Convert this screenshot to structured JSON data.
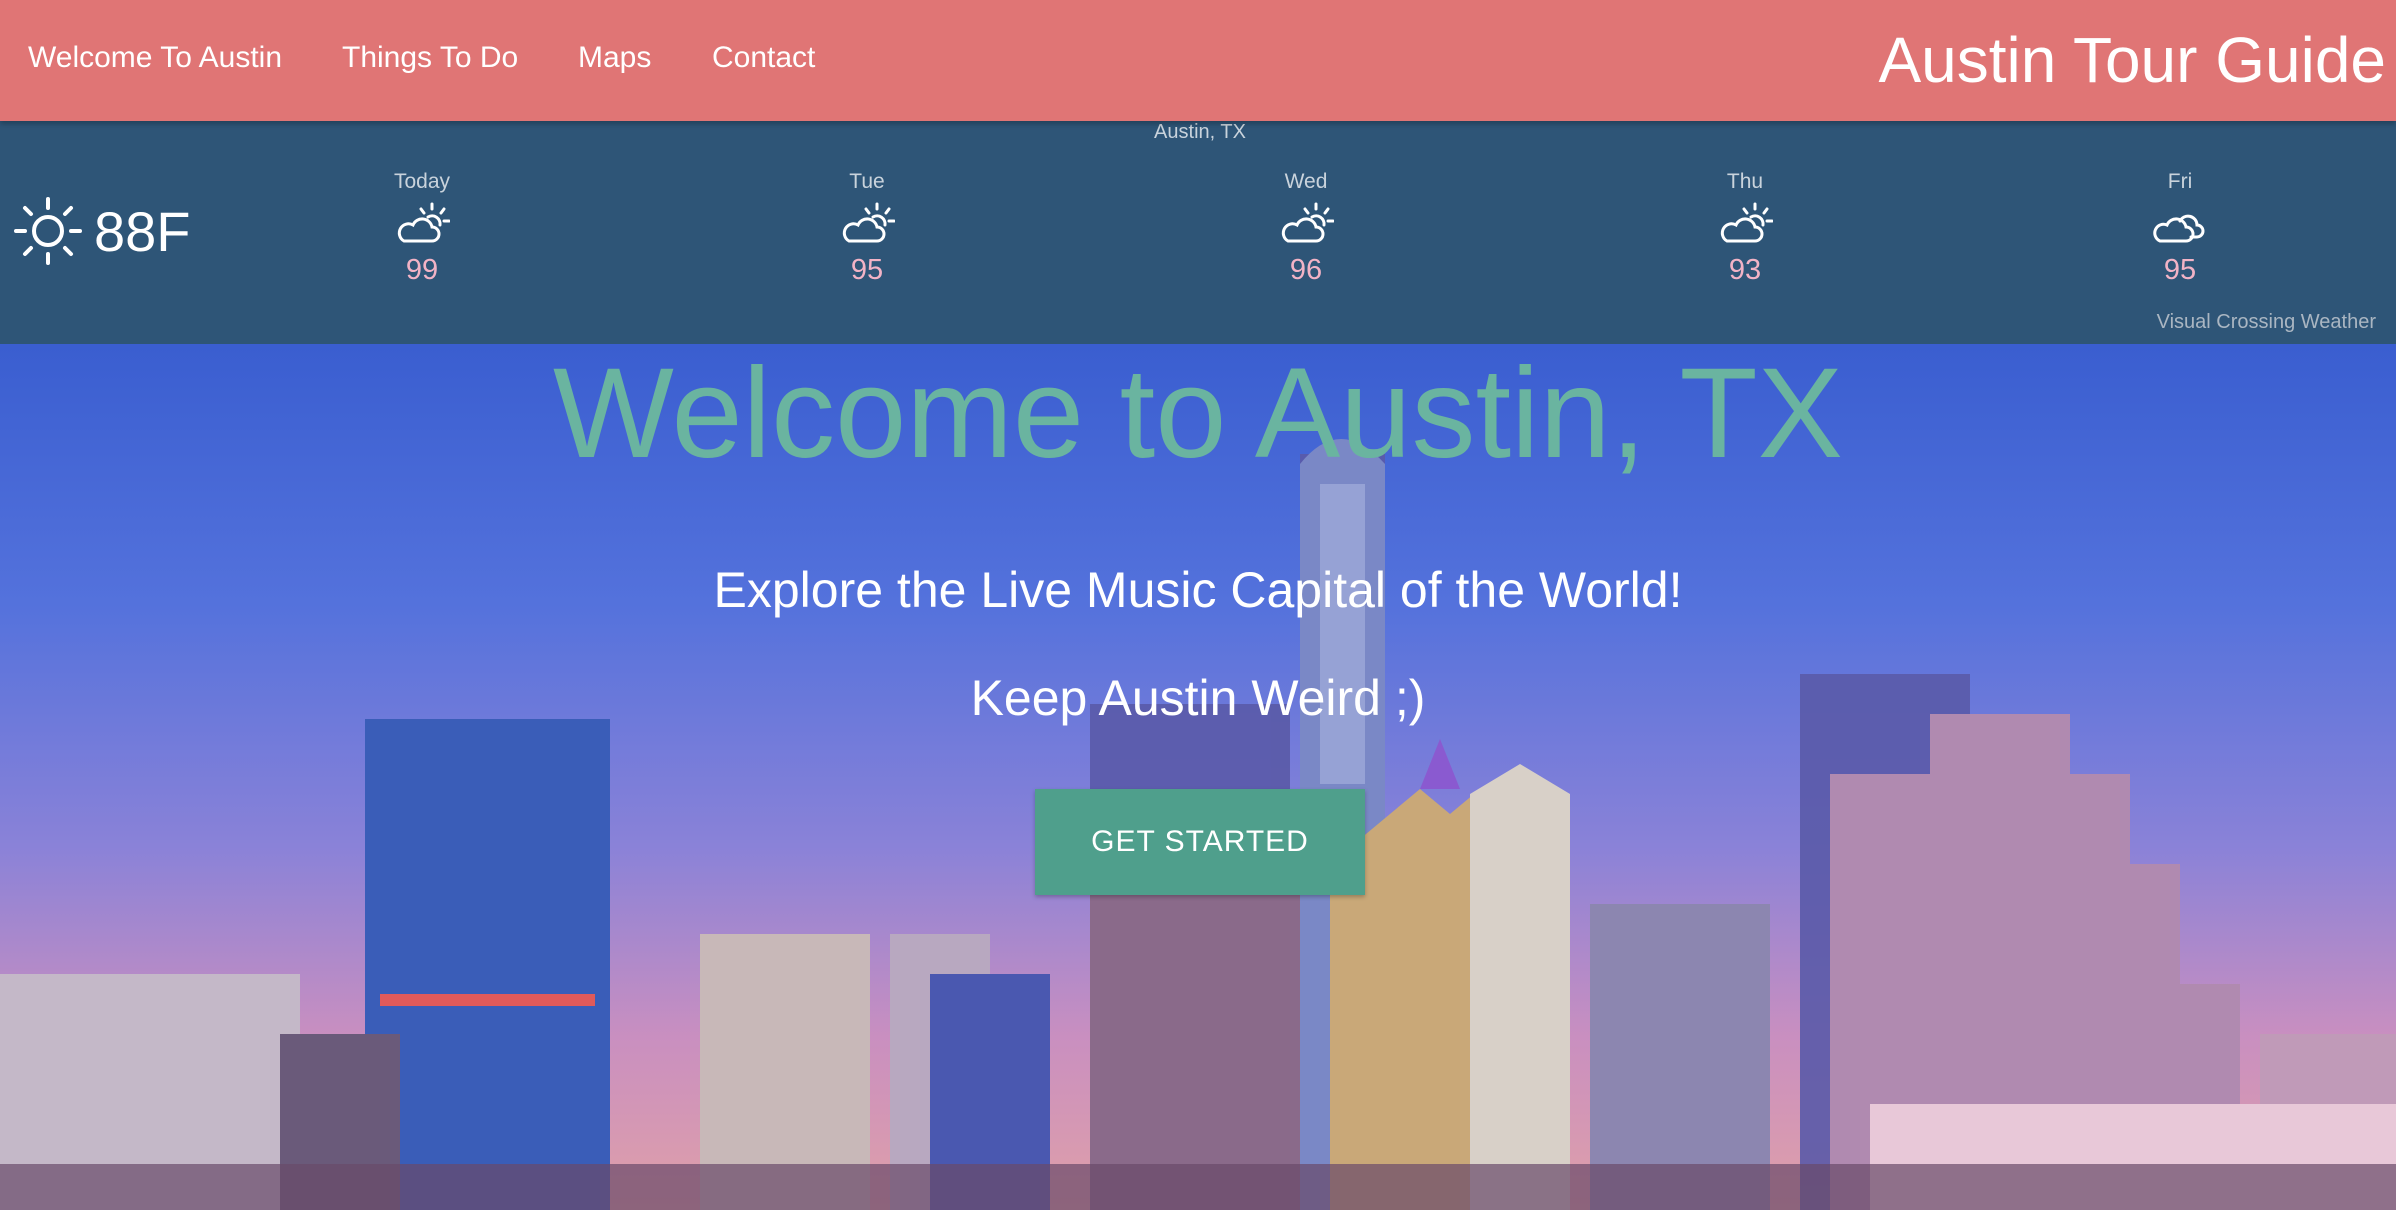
{
  "nav": {
    "links": [
      "Welcome To Austin",
      "Things To Do",
      "Maps",
      "Contact"
    ],
    "brand": "Austin Tour Guide"
  },
  "weather": {
    "location": "Austin, TX",
    "current_temp": "88F",
    "current_icon": "sun-icon",
    "days": [
      {
        "name": "Today",
        "icon": "partly-cloudy-icon",
        "temp": "99"
      },
      {
        "name": "Tue",
        "icon": "partly-cloudy-icon",
        "temp": "95"
      },
      {
        "name": "Wed",
        "icon": "partly-cloudy-icon",
        "temp": "96"
      },
      {
        "name": "Thu",
        "icon": "partly-cloudy-icon",
        "temp": "93"
      },
      {
        "name": "Fri",
        "icon": "cloudy-icon",
        "temp": "95"
      }
    ],
    "credit": "Visual Crossing Weather"
  },
  "hero": {
    "title": "Welcome to Austin, TX",
    "subtitle": "Explore the Live Music Capital of the World!",
    "tagline": "Keep Austin Weird ;)",
    "cta_label": "GET STARTED"
  },
  "colors": {
    "nav_bg": "#e07575",
    "weather_bg": "#2e5577",
    "hero_title": "#6ab4a0",
    "cta_bg": "#4f9f8c",
    "day_temp": "#f2b3c6"
  }
}
